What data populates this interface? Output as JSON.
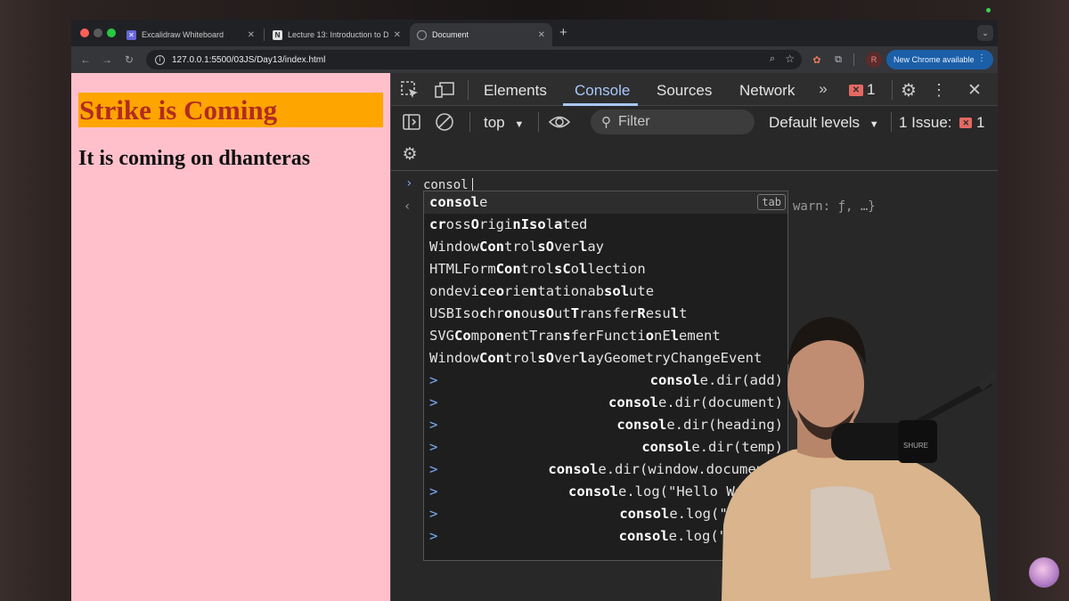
{
  "browser": {
    "tabs": [
      {
        "title": "Excalidraw Whiteboard",
        "icon": "excalidraw-icon",
        "active": false
      },
      {
        "title": "Lecture 13: Introduction to D",
        "icon": "notion-icon",
        "active": false
      },
      {
        "title": "Document",
        "icon": "globe-icon",
        "active": true
      }
    ],
    "new_tab_label": "+",
    "url": "127.0.0.1:5500/03JS/Day13/index.html",
    "profile_initial": "R",
    "update_button": "New Chrome available"
  },
  "page": {
    "heading": "Strike is Coming",
    "paragraph": "It is coming on dhanteras",
    "colors": {
      "background": "#ffc0cb",
      "heading_bg": "#ffa500",
      "heading_text": "#b22b22"
    }
  },
  "devtools": {
    "tabs": [
      "Elements",
      "Console",
      "Sources",
      "Network"
    ],
    "active_tab": "Console",
    "error_count": "1",
    "context": "top",
    "filter_placeholder": "Filter",
    "levels": "Default levels",
    "issues_label": "1 Issue:",
    "issues_count": "1",
    "console": {
      "input": "consol",
      "result_preview": "warn: ƒ, …}",
      "autocomplete_hint": "tab",
      "suggestions": [
        {
          "text": "console",
          "bold": "consol",
          "rest": "e"
        },
        {
          "text": "crossOriginIsolated"
        },
        {
          "text": "WindowControlsOverlay"
        },
        {
          "text": "HTMLFormControlsCollection"
        },
        {
          "text": "ondeviceorientationabsolute"
        },
        {
          "text": "USBIsochronousOutTransferResult"
        },
        {
          "text": "SVGComponentTransferFunctionElement"
        },
        {
          "text": "WindowControlsOverlayGeometryChangeEvent"
        }
      ],
      "history": [
        {
          "bold": "consol",
          "rest": "e.dir(add)"
        },
        {
          "bold": "consol",
          "rest": "e.dir(document)"
        },
        {
          "bold": "consol",
          "rest": "e.dir(heading)"
        },
        {
          "bold": "consol",
          "rest": "e.dir(temp)"
        },
        {
          "bold": "consol",
          "rest": "e.dir(window.documen"
        },
        {
          "bold": "consol",
          "rest": "e.log(\"Hello Wo"
        },
        {
          "bold": "consol",
          "rest": "e.log(\"h"
        },
        {
          "bold": "consol",
          "rest": "e.log(\""
        }
      ]
    }
  }
}
